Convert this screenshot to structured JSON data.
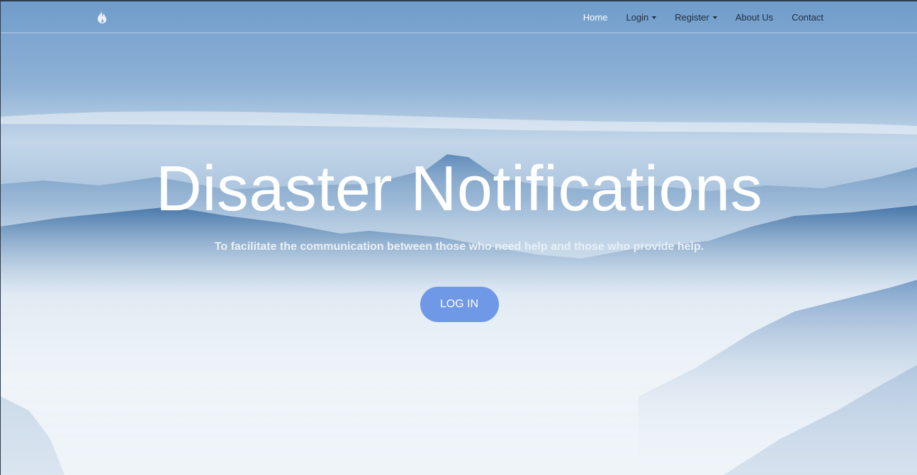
{
  "navbar": {
    "brand_icon": "flame-icon",
    "items": [
      {
        "label": "Home",
        "active": true,
        "dropdown": false
      },
      {
        "label": "Login",
        "active": false,
        "dropdown": true
      },
      {
        "label": "Register",
        "active": false,
        "dropdown": true
      },
      {
        "label": "About Us",
        "active": false,
        "dropdown": false
      },
      {
        "label": "Contact",
        "active": false,
        "dropdown": false
      }
    ]
  },
  "hero": {
    "title": "Disaster Notifications",
    "subtitle": "To facilitate the communication between those who need help and those who provide help.",
    "button_label": "LOG IN"
  },
  "colors": {
    "accent_button": "#6f98e6",
    "nav_text": "#1f2d3d",
    "nav_active_text": "#ffffff",
    "title_text": "#ffffff"
  }
}
